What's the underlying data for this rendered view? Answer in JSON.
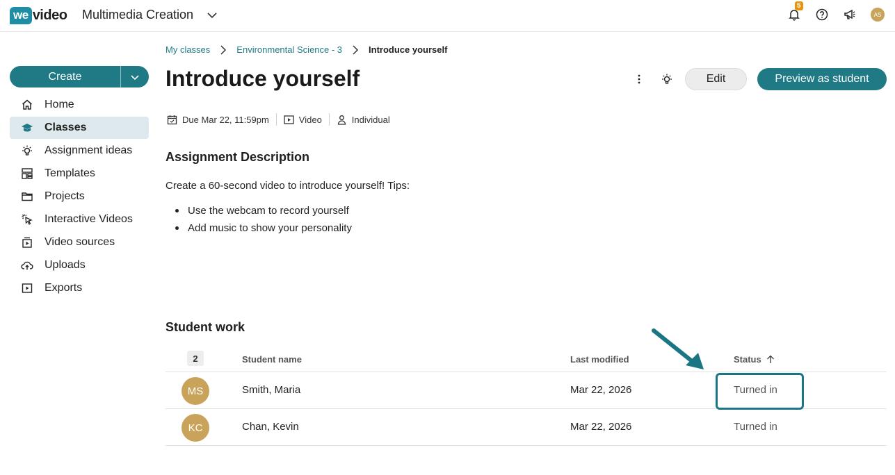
{
  "header": {
    "logo_badge": "we",
    "logo_rest": "video",
    "app_title": "Multimedia Creation",
    "notification_count": "5",
    "user_initials": "AS"
  },
  "sidebar": {
    "create_label": "Create",
    "items": [
      {
        "label": "Home",
        "icon": "home-icon"
      },
      {
        "label": "Classes",
        "icon": "graduation-cap-icon",
        "active": true
      },
      {
        "label": "Assignment ideas",
        "icon": "lightbulb-icon"
      },
      {
        "label": "Templates",
        "icon": "templates-icon"
      },
      {
        "label": "Projects",
        "icon": "folder-icon"
      },
      {
        "label": "Interactive Videos",
        "icon": "cursor-click-icon"
      },
      {
        "label": "Video sources",
        "icon": "video-source-icon"
      },
      {
        "label": "Uploads",
        "icon": "cloud-upload-icon"
      },
      {
        "label": "Exports",
        "icon": "export-icon"
      }
    ]
  },
  "breadcrumb": {
    "items": [
      "My classes",
      "Environmental Science - 3"
    ],
    "current": "Introduce yourself"
  },
  "assignment": {
    "title": "Introduce yourself",
    "due": "Due Mar 22, 11:59pm",
    "type": "Video",
    "mode": "Individual",
    "edit_label": "Edit",
    "preview_label": "Preview as student",
    "description_title": "Assignment Description",
    "description_text": "Create a 60-second video to introduce yourself! Tips:",
    "tips": [
      "Use the webcam to record yourself",
      "Add music to show your personality"
    ]
  },
  "student_work": {
    "title": "Student work",
    "count": "2",
    "columns": {
      "name": "Student name",
      "modified": "Last modified",
      "status": "Status"
    },
    "rows": [
      {
        "initials": "MS",
        "name": "Smith, Maria",
        "modified": "Mar 22, 2026",
        "status": "Turned in"
      },
      {
        "initials": "KC",
        "name": "Chan, Kevin",
        "modified": "Mar 22, 2026",
        "status": "Turned in"
      }
    ]
  },
  "colors": {
    "accent": "#1f7a86",
    "logo": "#1f8ea5",
    "avatar": "#c9a35a",
    "badge": "#e8930c"
  }
}
